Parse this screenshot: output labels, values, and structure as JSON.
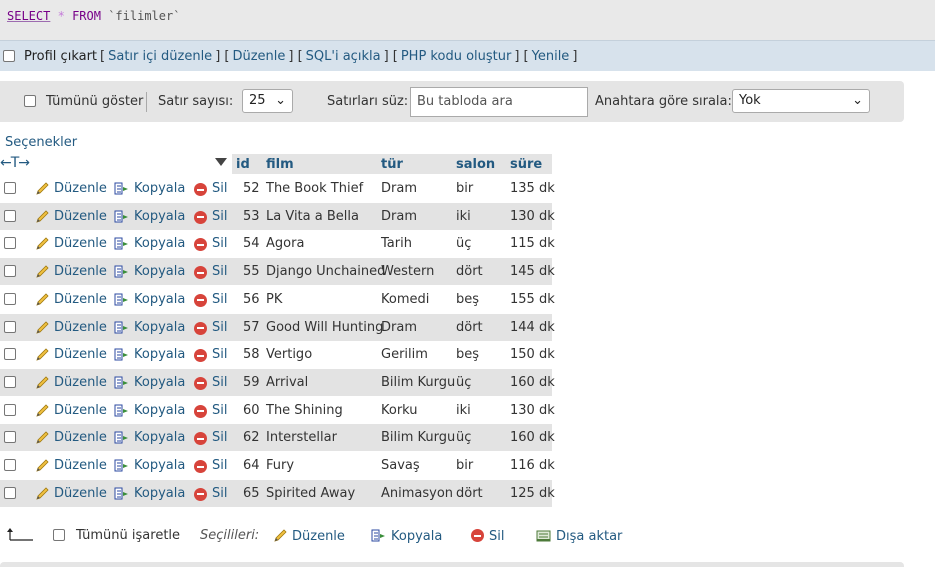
{
  "sql": {
    "select": "SELECT",
    "star": "*",
    "from": "FROM",
    "table": "`filimler`"
  },
  "linksbar": {
    "profile_label": "Profil çıkart",
    "links": [
      "Satır içi düzenle",
      "Düzenle",
      "SQL'i açıkla",
      "PHP kodu oluştur",
      "Yenile"
    ]
  },
  "nav": {
    "show_all": "Tümünü göster",
    "row_count_label": "Satır sayısı:",
    "row_count_value": "25",
    "filter_label": "Satırları süz:",
    "filter_placeholder": "Bu tabloda ara",
    "sort_label": "Anahtara göre sırala:",
    "sort_value": "Yok"
  },
  "options_link": "Seçenekler",
  "table": {
    "headers": [
      "id",
      "film",
      "tür",
      "salon",
      "süre"
    ],
    "actions": {
      "edit": "Düzenle",
      "copy": "Kopyala",
      "delete": "Sil"
    },
    "rows": [
      [
        "52",
        "The Book Thief",
        "Dram",
        "bir",
        "135 dk"
      ],
      [
        "53",
        "La Vita a Bella",
        "Dram",
        "iki",
        "130 dk"
      ],
      [
        "54",
        "Agora",
        "Tarih",
        "üç",
        "115 dk"
      ],
      [
        "55",
        "Django Unchained",
        "Western",
        "dört",
        "145 dk"
      ],
      [
        "56",
        "PK",
        "Komedi",
        "beş",
        "155 dk"
      ],
      [
        "57",
        "Good Will Hunting",
        "Dram",
        "dört",
        "144 dk"
      ],
      [
        "58",
        "Vertigo",
        "Gerilim",
        "beş",
        "150 dk"
      ],
      [
        "59",
        "Arrival",
        "Bilim Kurgu",
        "üç",
        "160 dk"
      ],
      [
        "60",
        "The Shining",
        "Korku",
        "iki",
        "130 dk"
      ],
      [
        "62",
        "Interstellar",
        "Bilim Kurgu",
        "üç",
        "160 dk"
      ],
      [
        "64",
        "Fury",
        "Savaş",
        "bir",
        "116 dk"
      ],
      [
        "65",
        "Spirited Away",
        "Animasyon",
        "dört",
        "125 dk"
      ]
    ]
  },
  "footer": {
    "check_all": "Tümünü işaretle",
    "selected_label": "Seçilileri:",
    "edit": "Düzenle",
    "copy": "Kopyala",
    "delete": "Sil",
    "export": "Dışa aktar"
  },
  "colors": {
    "link": "#235a81",
    "row_alt": "#e3e3e3",
    "delete_icon": "#d7443b"
  },
  "icons": {
    "edit": "pencil-icon",
    "copy": "copy-icon",
    "delete": "delete-icon",
    "export": "export-icon"
  }
}
